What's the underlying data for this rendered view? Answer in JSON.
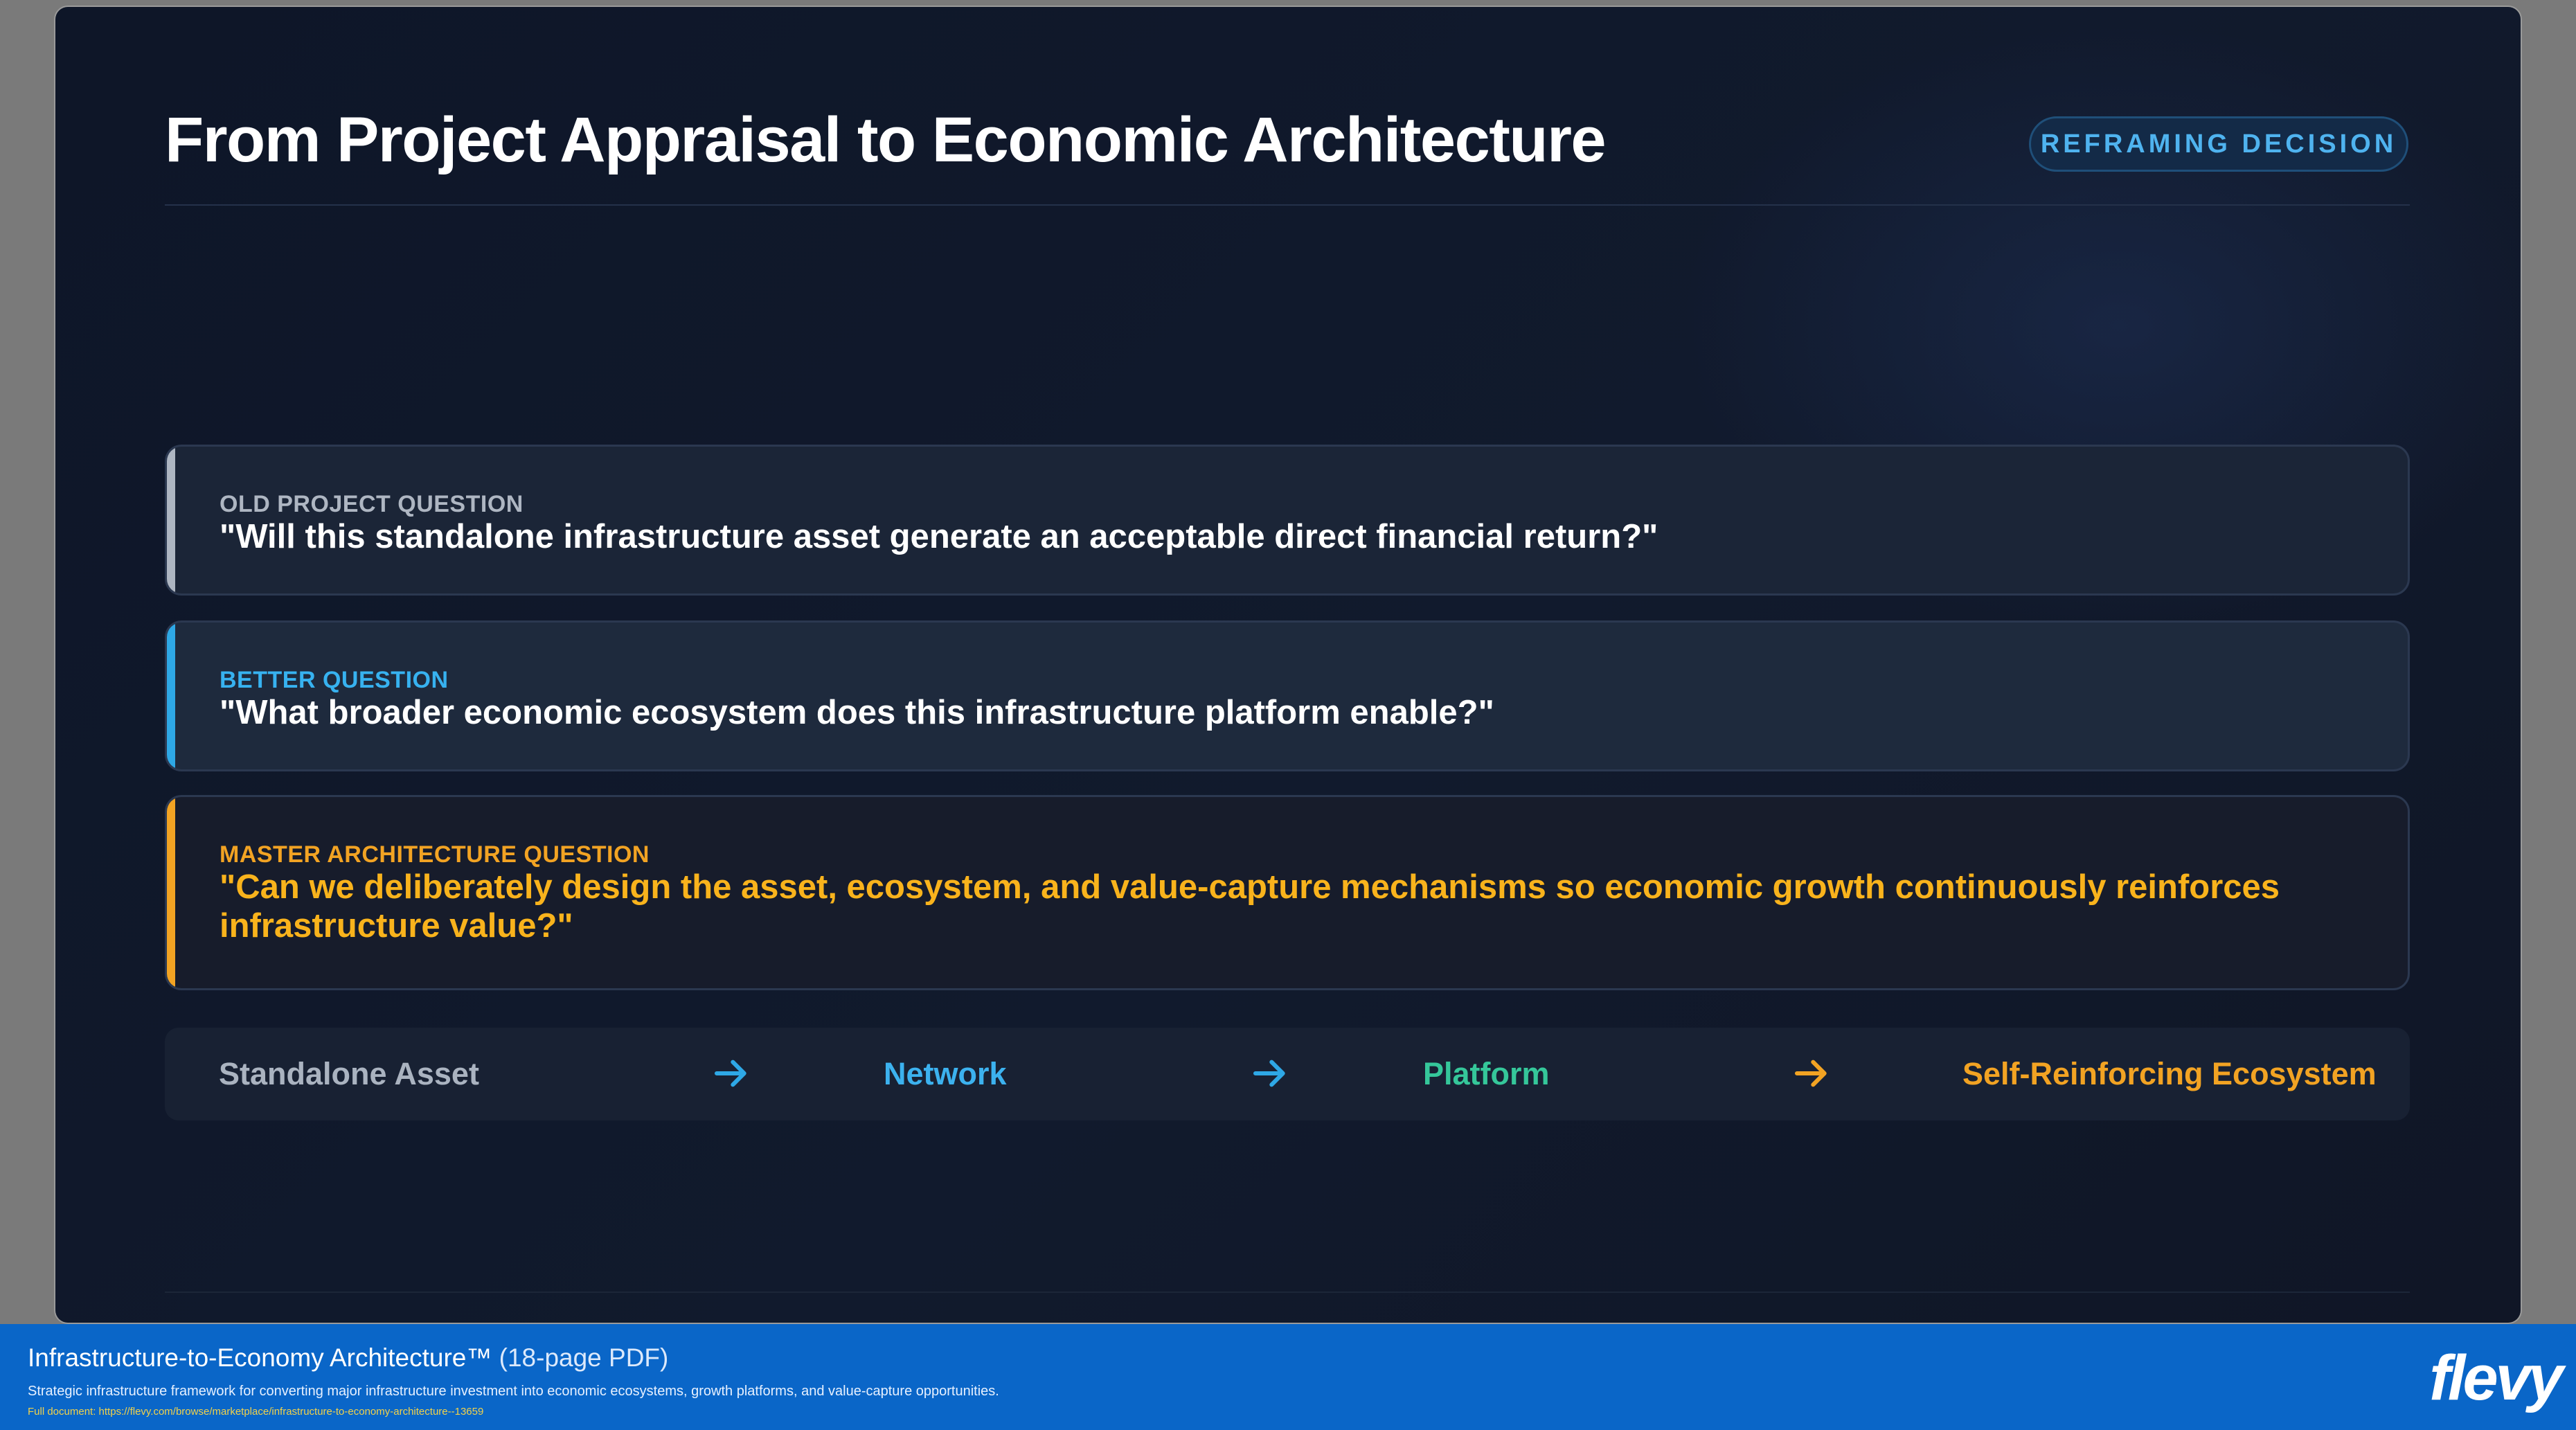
{
  "slide": {
    "title": "From Project Appraisal to Economic Architecture",
    "tag": "REFRAMING DECISION"
  },
  "questions": [
    {
      "label": "OLD PROJECT QUESTION",
      "text": "\"Will this standalone infrastructure asset generate an acceptable direct financial return?\"",
      "accent": "#aeb6c2"
    },
    {
      "label": "BETTER QUESTION",
      "text": "\"What broader economic ecosystem does this infrastructure platform enable?\"",
      "accent": "#2ea8e6"
    },
    {
      "label": "MASTER ARCHITECTURE QUESTION",
      "text": "\"Can we deliberately design the asset, ecosystem, and value-capture mechanisms so economic growth continuously reinforces infrastructure value?\"",
      "accent": "#f2a323"
    }
  ],
  "progression": {
    "steps": [
      "Standalone Asset",
      "Network",
      "Platform",
      "Self-Reinforcing Ecosystem"
    ],
    "arrow_icon": "arrow-right-icon",
    "colors": [
      "#aab3c0",
      "#3cb2ef",
      "#35c79a",
      "#f2a323"
    ]
  },
  "footer": {
    "title": "Infrastructure-to-Economy Architecture™",
    "pages": "(18-page PDF)",
    "description": "Strategic infrastructure framework for converting major infrastructure investment into economic ecosystems, growth platforms, and value-capture opportunities.",
    "link": "Full document: https://flevy.com/browse/marketplace/infrastructure-to-economy-architecture--13659",
    "logo": "flevy"
  }
}
